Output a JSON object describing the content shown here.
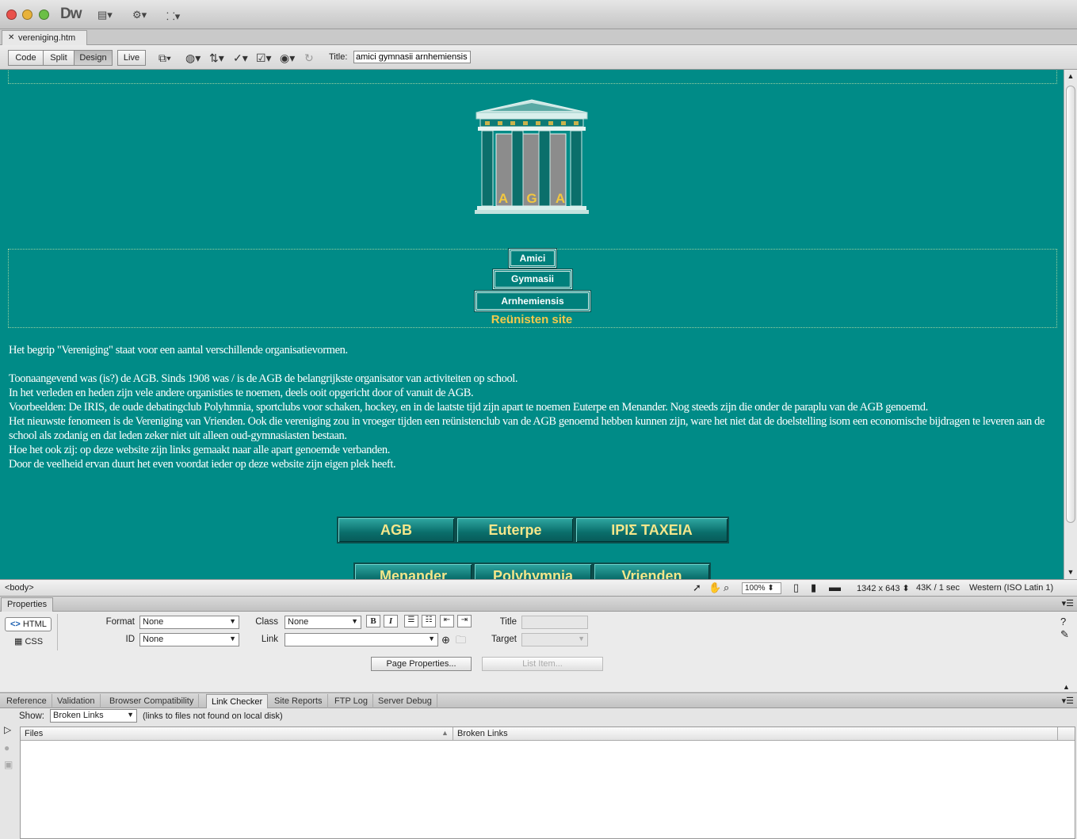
{
  "app": {
    "logo": "Dw",
    "document_tab": "vereniging.htm"
  },
  "toolbar": {
    "views": [
      "Code",
      "Split",
      "Design",
      "Live"
    ],
    "active_view": "Design",
    "title_label": "Title:",
    "title_value": "amici gymnasii arnhemiensis"
  },
  "page": {
    "logo_letters": [
      "A",
      "G",
      "A"
    ],
    "nav_plates": [
      "Amici",
      "Gymnasii",
      "Arnhemiensis"
    ],
    "subtitle": "Reünisten site",
    "intro": "Het begrip \"Vereniging\" staat voor een aantal verschillende organisatievormen.",
    "paragraph_lines": [
      "Toonaangevend was (is?) de AGB. Sinds 1908 was / is de AGB de belangrijkste organisator van activiteiten op school.",
      "In het verleden en heden zijn vele andere organisties te noemen, deels ooit opgericht door of vanuit de AGB.",
      "Voorbeelden: De IRIS, de oude debatingclub Polyhmnia, sportclubs voor schaken, hockey, en in de laatste tijd zijn apart te noemen Euterpe en Menander. Nog steeds zijn die onder de paraplu van de AGB genoemd.",
      "Het nieuwste fenomeen is de Vereniging van Vrienden. Ook die vereniging zou in vroeger tijden een reünistenclub van de AGB genoemd hebben kunnen zijn, ware het niet dat de doelstelling isom een economische bijdragen te leveren aan de school als zodanig en dat leden zeker niet uit alleen oud-gymnasiasten bestaan.",
      "Hoe het ook zij: op deze website zijn links gemaakt naar alle apart genoemde verbanden.",
      "Door de veelheid ervan duurt het even voordat ieder op deze website zijn eigen plek heeft."
    ],
    "nav_buttons_row1": [
      "AGB",
      "Euterpe",
      "ΙΡΙΣ  ΤΑΧΕΙΑ"
    ],
    "nav_buttons_row2": [
      "Menander",
      "Polyhymnia",
      "Vrienden"
    ]
  },
  "status": {
    "tag": "<body>",
    "zoom": "100%",
    "dimensions": "1342 x 643",
    "size_time": "43K / 1 sec",
    "encoding": "Western (ISO Latin 1)"
  },
  "properties": {
    "panel_title": "Properties",
    "html_label": "HTML",
    "css_label": "CSS",
    "format_label": "Format",
    "format_value": "None",
    "id_label": "ID",
    "id_value": "None",
    "class_label": "Class",
    "class_value": "None",
    "link_label": "Link",
    "title_label": "Title",
    "target_label": "Target",
    "bold": "B",
    "italic": "I",
    "page_properties": "Page Properties...",
    "list_item": "List Item..."
  },
  "results": {
    "tabs": [
      "Reference",
      "Validation",
      "Browser Compatibility",
      "Link Checker",
      "Site Reports",
      "FTP Log",
      "Server Debug"
    ],
    "active_tab": "Link Checker",
    "show_label": "Show:",
    "show_value": "Broken Links",
    "show_note": "(links to files not found on local disk)",
    "col_files": "Files",
    "col_broken": "Broken Links"
  }
}
